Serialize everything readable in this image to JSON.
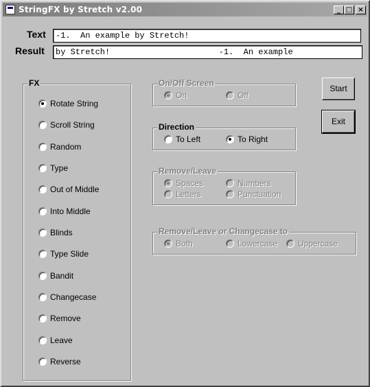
{
  "window": {
    "title": "StringFX by Stretch v2.00",
    "controls": [
      "_",
      "□",
      "×"
    ]
  },
  "text_label": "Text",
  "text_value": "-1.  An example by Stretch!",
  "result_label": "Result",
  "result_value": "by Stretch!                      -1.  An example",
  "fx": {
    "title": "FX",
    "options": [
      "Rotate String",
      "Scroll String",
      "Random",
      "Type",
      "Out of Middle",
      "Into Middle",
      "Blinds",
      "Type Slide",
      "Bandit",
      "Changecase",
      "Remove",
      "Leave",
      "Reverse"
    ],
    "selected": "Rotate String"
  },
  "onoff": {
    "title": "On/Off Screen",
    "on": "On",
    "off": "Off"
  },
  "direction": {
    "title": "Direction",
    "left": "To Left",
    "right": "To Right"
  },
  "removeleave": {
    "title": "Remove/Leave",
    "spaces": "Spaces",
    "numbers": "Numbers",
    "letters": "Letters",
    "punctuation": "Punctuation"
  },
  "changecase": {
    "title": "Remove/Leave or Changecase to",
    "both": "Both",
    "lower": "Lowercase",
    "upper": "Uppercase"
  },
  "buttons": {
    "start": "Start",
    "exit": "Exit"
  }
}
